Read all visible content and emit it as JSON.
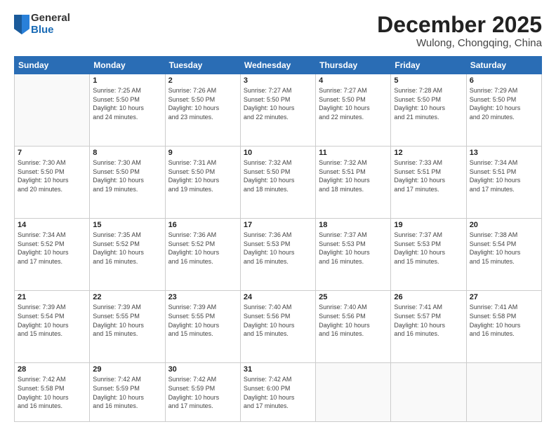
{
  "header": {
    "logo_general": "General",
    "logo_blue": "Blue",
    "month_title": "December 2025",
    "subtitle": "Wulong, Chongqing, China"
  },
  "days_of_week": [
    "Sunday",
    "Monday",
    "Tuesday",
    "Wednesday",
    "Thursday",
    "Friday",
    "Saturday"
  ],
  "weeks": [
    [
      {
        "day": "",
        "info": ""
      },
      {
        "day": "1",
        "info": "Sunrise: 7:25 AM\nSunset: 5:50 PM\nDaylight: 10 hours\nand 24 minutes."
      },
      {
        "day": "2",
        "info": "Sunrise: 7:26 AM\nSunset: 5:50 PM\nDaylight: 10 hours\nand 23 minutes."
      },
      {
        "day": "3",
        "info": "Sunrise: 7:27 AM\nSunset: 5:50 PM\nDaylight: 10 hours\nand 22 minutes."
      },
      {
        "day": "4",
        "info": "Sunrise: 7:27 AM\nSunset: 5:50 PM\nDaylight: 10 hours\nand 22 minutes."
      },
      {
        "day": "5",
        "info": "Sunrise: 7:28 AM\nSunset: 5:50 PM\nDaylight: 10 hours\nand 21 minutes."
      },
      {
        "day": "6",
        "info": "Sunrise: 7:29 AM\nSunset: 5:50 PM\nDaylight: 10 hours\nand 20 minutes."
      }
    ],
    [
      {
        "day": "7",
        "info": "Sunrise: 7:30 AM\nSunset: 5:50 PM\nDaylight: 10 hours\nand 20 minutes."
      },
      {
        "day": "8",
        "info": "Sunrise: 7:30 AM\nSunset: 5:50 PM\nDaylight: 10 hours\nand 19 minutes."
      },
      {
        "day": "9",
        "info": "Sunrise: 7:31 AM\nSunset: 5:50 PM\nDaylight: 10 hours\nand 19 minutes."
      },
      {
        "day": "10",
        "info": "Sunrise: 7:32 AM\nSunset: 5:50 PM\nDaylight: 10 hours\nand 18 minutes."
      },
      {
        "day": "11",
        "info": "Sunrise: 7:32 AM\nSunset: 5:51 PM\nDaylight: 10 hours\nand 18 minutes."
      },
      {
        "day": "12",
        "info": "Sunrise: 7:33 AM\nSunset: 5:51 PM\nDaylight: 10 hours\nand 17 minutes."
      },
      {
        "day": "13",
        "info": "Sunrise: 7:34 AM\nSunset: 5:51 PM\nDaylight: 10 hours\nand 17 minutes."
      }
    ],
    [
      {
        "day": "14",
        "info": "Sunrise: 7:34 AM\nSunset: 5:52 PM\nDaylight: 10 hours\nand 17 minutes."
      },
      {
        "day": "15",
        "info": "Sunrise: 7:35 AM\nSunset: 5:52 PM\nDaylight: 10 hours\nand 16 minutes."
      },
      {
        "day": "16",
        "info": "Sunrise: 7:36 AM\nSunset: 5:52 PM\nDaylight: 10 hours\nand 16 minutes."
      },
      {
        "day": "17",
        "info": "Sunrise: 7:36 AM\nSunset: 5:53 PM\nDaylight: 10 hours\nand 16 minutes."
      },
      {
        "day": "18",
        "info": "Sunrise: 7:37 AM\nSunset: 5:53 PM\nDaylight: 10 hours\nand 16 minutes."
      },
      {
        "day": "19",
        "info": "Sunrise: 7:37 AM\nSunset: 5:53 PM\nDaylight: 10 hours\nand 15 minutes."
      },
      {
        "day": "20",
        "info": "Sunrise: 7:38 AM\nSunset: 5:54 PM\nDaylight: 10 hours\nand 15 minutes."
      }
    ],
    [
      {
        "day": "21",
        "info": "Sunrise: 7:39 AM\nSunset: 5:54 PM\nDaylight: 10 hours\nand 15 minutes."
      },
      {
        "day": "22",
        "info": "Sunrise: 7:39 AM\nSunset: 5:55 PM\nDaylight: 10 hours\nand 15 minutes."
      },
      {
        "day": "23",
        "info": "Sunrise: 7:39 AM\nSunset: 5:55 PM\nDaylight: 10 hours\nand 15 minutes."
      },
      {
        "day": "24",
        "info": "Sunrise: 7:40 AM\nSunset: 5:56 PM\nDaylight: 10 hours\nand 15 minutes."
      },
      {
        "day": "25",
        "info": "Sunrise: 7:40 AM\nSunset: 5:56 PM\nDaylight: 10 hours\nand 16 minutes."
      },
      {
        "day": "26",
        "info": "Sunrise: 7:41 AM\nSunset: 5:57 PM\nDaylight: 10 hours\nand 16 minutes."
      },
      {
        "day": "27",
        "info": "Sunrise: 7:41 AM\nSunset: 5:58 PM\nDaylight: 10 hours\nand 16 minutes."
      }
    ],
    [
      {
        "day": "28",
        "info": "Sunrise: 7:42 AM\nSunset: 5:58 PM\nDaylight: 10 hours\nand 16 minutes."
      },
      {
        "day": "29",
        "info": "Sunrise: 7:42 AM\nSunset: 5:59 PM\nDaylight: 10 hours\nand 16 minutes."
      },
      {
        "day": "30",
        "info": "Sunrise: 7:42 AM\nSunset: 5:59 PM\nDaylight: 10 hours\nand 17 minutes."
      },
      {
        "day": "31",
        "info": "Sunrise: 7:42 AM\nSunset: 6:00 PM\nDaylight: 10 hours\nand 17 minutes."
      },
      {
        "day": "",
        "info": ""
      },
      {
        "day": "",
        "info": ""
      },
      {
        "day": "",
        "info": ""
      }
    ]
  ]
}
